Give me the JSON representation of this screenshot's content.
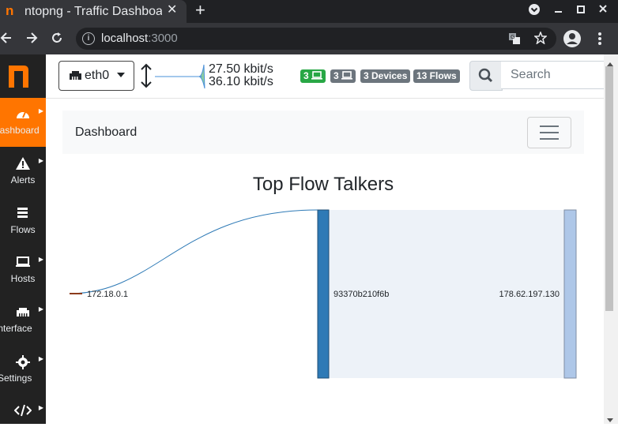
{
  "browser": {
    "tab_logo": "n",
    "tab_title": "ntopng - Traffic Dashboard",
    "tab_close": "✕",
    "new_tab": "+",
    "url_host": "localhost",
    "url_port": ":3000"
  },
  "sidebar": {
    "logo": "n",
    "items": [
      {
        "label": "Dashboard",
        "icon": "gauge-icon",
        "active": true
      },
      {
        "label": "Alerts",
        "icon": "warning-icon"
      },
      {
        "label": "Flows",
        "icon": "stream-icon"
      },
      {
        "label": "Hosts",
        "icon": "laptop-icon"
      },
      {
        "label": "Interface",
        "icon": "ethernet-icon"
      },
      {
        "label": "Settings",
        "icon": "gear-icon"
      },
      {
        "label": "",
        "icon": "code-icon"
      }
    ]
  },
  "topbar": {
    "interface": "eth0",
    "traffic_up": "27.50 kbit/s",
    "traffic_down": "36.10 kbit/s",
    "badges": [
      {
        "text": "3",
        "icon": "laptop-icon",
        "color": "#28a745"
      },
      {
        "text": "3",
        "icon": "laptop-icon",
        "color": "#6c757d"
      },
      {
        "text": "3 Devices",
        "color": "#6c757d"
      },
      {
        "text": "13 Flows",
        "color": "#6c757d"
      }
    ],
    "search_placeholder": "Search"
  },
  "content": {
    "breadcrumb": "Dashboard",
    "chart_title": "Top Flow Talkers",
    "sankey": {
      "nodes": [
        "172.18.0.1",
        "93370b210f6b",
        "178.62.197.130"
      ],
      "links": [
        {
          "source": "172.18.0.1",
          "target": "93370b210f6b"
        },
        {
          "source": "93370b210f6b",
          "target": "178.62.197.130"
        }
      ]
    }
  },
  "colors": {
    "accent": "#ff7500",
    "sidebar": "#222222",
    "node_primary": "#2e7ab6",
    "node_secondary": "#aec7e8"
  }
}
